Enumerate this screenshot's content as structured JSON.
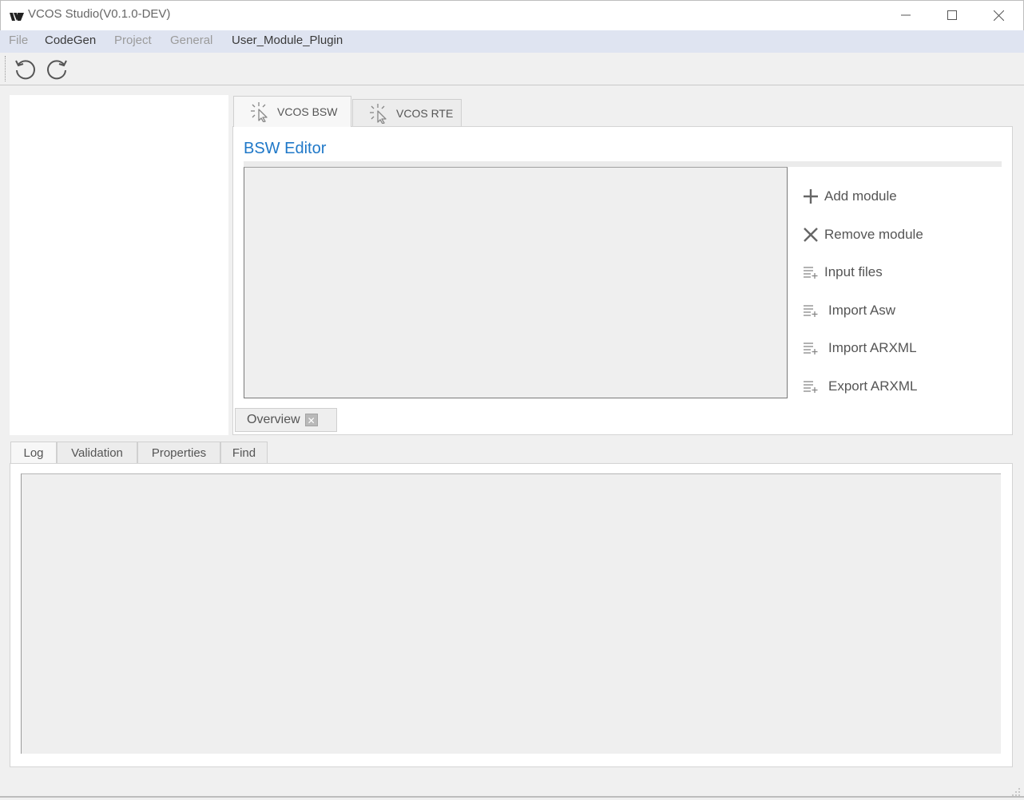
{
  "window": {
    "title": "VCOS Studio(V0.1.0-DEV)"
  },
  "menu": [
    {
      "label": "File",
      "enabled": false
    },
    {
      "label": "CodeGen",
      "enabled": true
    },
    {
      "label": "Project",
      "enabled": false
    },
    {
      "label": "General",
      "enabled": false
    },
    {
      "label": "User_Module_Plugin",
      "enabled": true
    }
  ],
  "toolbar": {
    "undo_icon": "undo-icon",
    "redo_icon": "redo-icon"
  },
  "editor_tabs": [
    {
      "label": "VCOS BSW",
      "active": true
    },
    {
      "label": "VCOS RTE",
      "active": false
    }
  ],
  "editor": {
    "title": "BSW Editor",
    "actions": [
      {
        "label": "Add module",
        "icon": "plus-icon"
      },
      {
        "label": "Remove module",
        "icon": "x-icon"
      },
      {
        "label": "Input files",
        "icon": "list-add-icon"
      },
      {
        "label": "Import Asw",
        "icon": "list-add-icon"
      },
      {
        "label": "Import ARXML",
        "icon": "list-add-icon"
      },
      {
        "label": "Export ARXML",
        "icon": "list-add-icon"
      }
    ],
    "overview_tab": {
      "label": "Overview",
      "close": "✕"
    }
  },
  "bottom_tabs": [
    {
      "label": "Log",
      "active": true
    },
    {
      "label": "Validation",
      "active": false
    },
    {
      "label": "Properties",
      "active": false
    },
    {
      "label": "Find",
      "active": false
    }
  ],
  "colors": {
    "accent": "#1f78c8",
    "menubar": "#dfe4f1"
  }
}
